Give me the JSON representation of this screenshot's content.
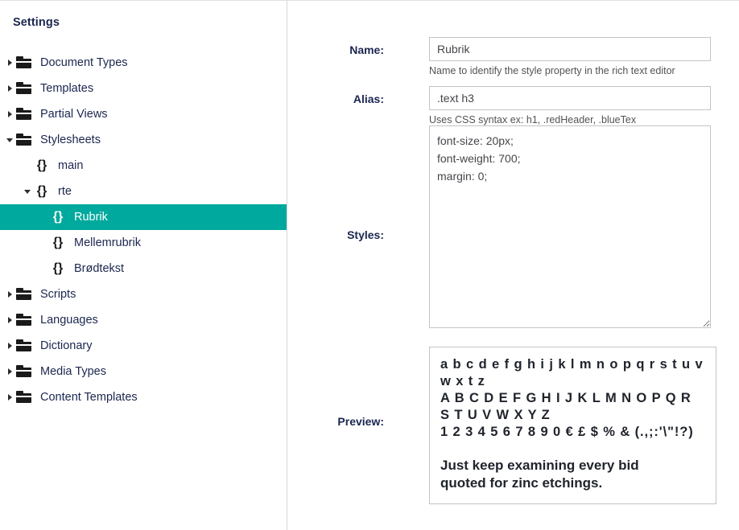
{
  "sidebar": {
    "title": "Settings",
    "tree": [
      {
        "label": "Document Types",
        "icon": "folder-icon",
        "caret": "right",
        "level": 0,
        "selected": false
      },
      {
        "label": "Templates",
        "icon": "folder-icon",
        "caret": "right",
        "level": 0,
        "selected": false
      },
      {
        "label": "Partial Views",
        "icon": "folder-icon",
        "caret": "right",
        "level": 0,
        "selected": false
      },
      {
        "label": "Stylesheets",
        "icon": "folder-icon",
        "caret": "down",
        "level": 0,
        "selected": false
      },
      {
        "label": "main",
        "icon": "braces-icon",
        "caret": "none",
        "level": 1,
        "selected": false
      },
      {
        "label": "rte",
        "icon": "braces-icon",
        "caret": "down",
        "level": 1,
        "selected": false
      },
      {
        "label": "Rubrik",
        "icon": "braces-icon",
        "caret": "none",
        "level": 2,
        "selected": true
      },
      {
        "label": "Mellemrubrik",
        "icon": "braces-icon",
        "caret": "none",
        "level": 2,
        "selected": false
      },
      {
        "label": "Brødtekst",
        "icon": "braces-icon",
        "caret": "none",
        "level": 2,
        "selected": false
      },
      {
        "label": "Scripts",
        "icon": "folder-icon",
        "caret": "right",
        "level": 0,
        "selected": false
      },
      {
        "label": "Languages",
        "icon": "folder-icon",
        "caret": "right",
        "level": 0,
        "selected": false
      },
      {
        "label": "Dictionary",
        "icon": "folder-icon",
        "caret": "right",
        "level": 0,
        "selected": false
      },
      {
        "label": "Media Types",
        "icon": "folder-icon",
        "caret": "right",
        "level": 0,
        "selected": false
      },
      {
        "label": "Content Templates",
        "icon": "folder-icon",
        "caret": "right",
        "level": 0,
        "selected": false
      }
    ]
  },
  "form": {
    "name": {
      "label": "Name:",
      "value": "Rubrik",
      "placeholder": "",
      "help": "Name to identify the style property in the rich text editor"
    },
    "alias": {
      "label": "Alias:",
      "value": ".text h3",
      "placeholder": "",
      "help": "Uses CSS syntax ex: h1, .redHeader, .blueTex"
    },
    "styles": {
      "label": "Styles:",
      "value": "font-size: 20px;\nfont-weight: 700;\nmargin: 0;",
      "placeholder": ""
    },
    "preview": {
      "label": "Preview:",
      "specimen_lowercase": "a b c d e f g h i j k l m n o p q r s t u v w x t z",
      "specimen_uppercase": "A B C D E F G H I J K L M N O P Q R S T U V W X Y Z",
      "specimen_numbers": "1 2 3 4 5 6 7 8 9 0 € £ $ % & (.,;:'\\\"!?)",
      "pangram": "Just keep examining every bid quoted for zinc etchings."
    }
  },
  "colors": {
    "accent_teal": "#00a99d",
    "text_dark": "#1b264f",
    "border_gray": "#c4c4c4",
    "panel_divider": "#d8d7d9"
  }
}
